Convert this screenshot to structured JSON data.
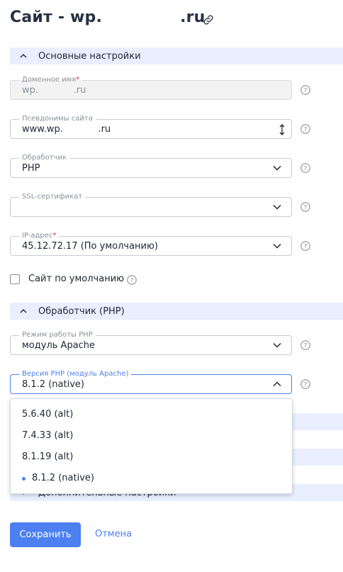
{
  "page": {
    "title": "Сайт - wp.              .ru"
  },
  "sections": {
    "basic": {
      "title": "Основные настройки"
    },
    "handler": {
      "title": "Обработчик (PHP)"
    },
    "extra": {
      "title": "Дополнительные настройки"
    }
  },
  "fields": {
    "domain": {
      "label": "Доменное имя",
      "required": "*",
      "value": "wp.            .ru"
    },
    "aliases": {
      "label": "Псевдонимы сайта",
      "value": "www.wp.            .ru"
    },
    "handler": {
      "label": "Обработчик",
      "value": "PHP"
    },
    "ssl": {
      "label": "SSL-сертификат",
      "value": ""
    },
    "ip": {
      "label": "IP-адрес",
      "required": "*",
      "value": "45.12.72.17 (По умолчанию)"
    },
    "php_mode": {
      "label": "Режим работы PHP",
      "value": "модуль Apache"
    },
    "php_version": {
      "label": "Версия PHP (модуль Apache)",
      "value": "8.1.2 (native)"
    }
  },
  "default_site": {
    "label": "Сайт по умолчанию",
    "checked": false
  },
  "php_version_options": [
    "5.6.40 (alt)",
    "7.4.33 (alt)",
    "8.1.19 (alt)",
    "8.1.2 (native)"
  ],
  "actions": {
    "save": "Сохранить",
    "cancel": "Отмена"
  },
  "colors": {
    "accent": "#4c7ff0",
    "section_bg": "#e9efff",
    "required": "#e0263b"
  }
}
